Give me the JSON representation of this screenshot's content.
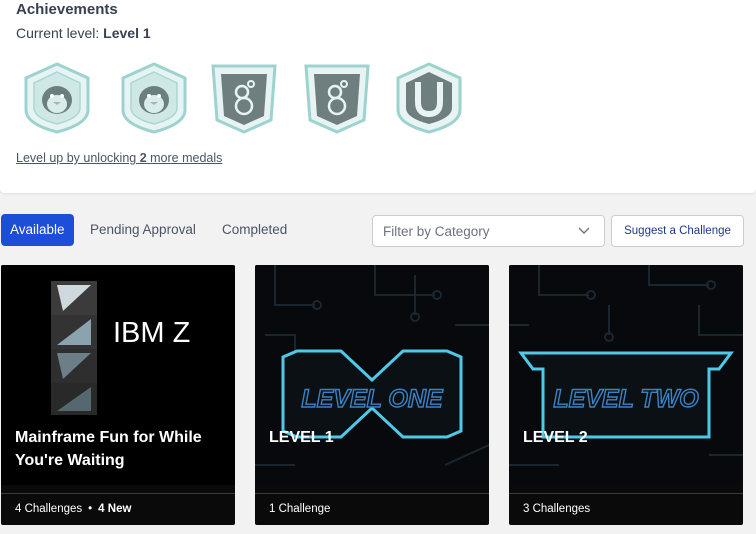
{
  "achievements": {
    "title": "Achievements",
    "current_level_label": "Current level: ",
    "current_level_value": "Level 1",
    "medals": [
      {
        "icon": "penguin-medal-icon"
      },
      {
        "icon": "penguin-medal-icon"
      },
      {
        "icon": "bubbles-medal-icon"
      },
      {
        "icon": "bubbles-medal-icon"
      },
      {
        "icon": "letter-u-medal-icon"
      }
    ],
    "level_up_prefix": "Level up by unlocking ",
    "level_up_count": "2",
    "level_up_suffix": " more medals"
  },
  "tabs": [
    {
      "label": "Available",
      "active": true
    },
    {
      "label": "Pending Approval",
      "active": false
    },
    {
      "label": "Completed",
      "active": false
    }
  ],
  "filter": {
    "placeholder": "Filter by Category"
  },
  "suggest_button": {
    "label": "Suggest a Challenge"
  },
  "cards": [
    {
      "title": "Mainframe Fun for While You're Waiting",
      "art_text": "IBM Z",
      "footer_count": "4 Challenges",
      "footer_new": "4 New"
    },
    {
      "title": "LEVEL 1",
      "art_text": "LEVEL ONE",
      "footer_count": "1 Challenge"
    },
    {
      "title": "LEVEL 2",
      "art_text": "LEVEL TWO",
      "footer_count": "3 Challenges"
    }
  ],
  "colors": {
    "accent": "#1d4ed8",
    "medal": "#7fc7c4",
    "neon": "#4ec9e8"
  }
}
